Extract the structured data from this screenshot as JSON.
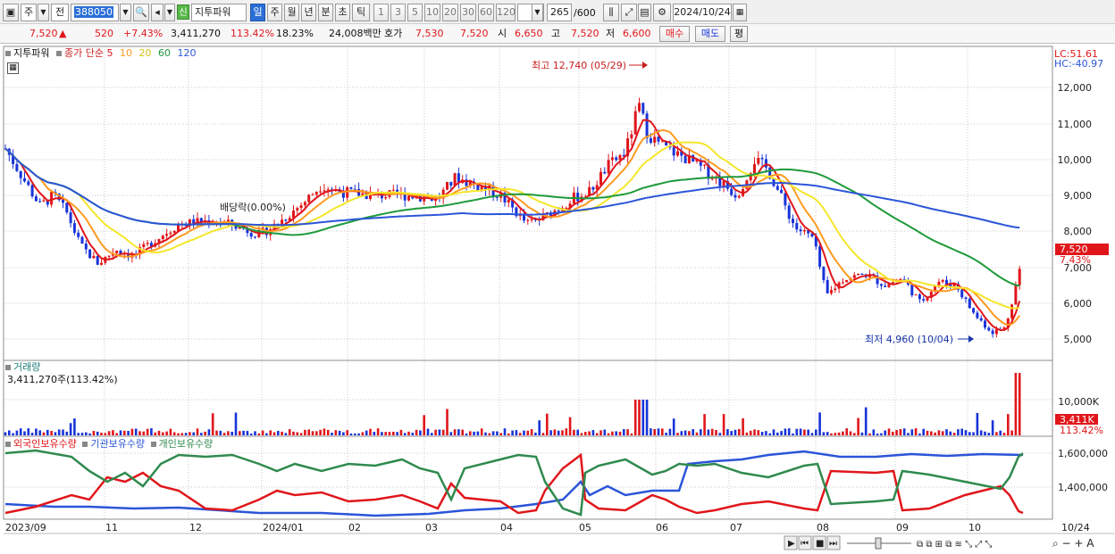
{
  "toolbar": {
    "jong_label": "주",
    "jeon_label": "전",
    "code": "388050",
    "sin_badge": "신",
    "stock_name": "지투파워",
    "periods": [
      "일",
      "주",
      "월",
      "년",
      "분",
      "초",
      "틱"
    ],
    "active_period": "일",
    "minute_options": [
      "1",
      "3",
      "5",
      "10",
      "20",
      "30",
      "60",
      "120"
    ],
    "count": "265",
    "count_total": "/600",
    "date": "2024/10/24"
  },
  "quote": {
    "price": "7,520",
    "change_sign": "▲",
    "change": "520",
    "change_pct": "+7.43%",
    "volume": "3,411,270",
    "volume_ratio": "113.42%",
    "turnover": "18.23%",
    "amount": "24,008백만",
    "hoga_label": "호가",
    "ask": "7,530",
    "bid": "7,520",
    "open_label": "시",
    "open": "6,650",
    "high_label": "고",
    "high": "7,520",
    "low_label": "저",
    "low": "6,600",
    "buy_label": "매수",
    "sell_label": "매도",
    "avg_label": "평"
  },
  "price_panel": {
    "name": "지투파워",
    "ma_title": "종가 단순",
    "ma_periods": [
      "5",
      "10",
      "20",
      "60",
      "120"
    ],
    "ma_colors": [
      "#e0161b",
      "#ff9a1f",
      "#f5e62a",
      "#1e9a3a",
      "#2b55d8"
    ],
    "lc": "LC:51.61",
    "hc": "HC:-40.97",
    "y_ticks": [
      "12,000",
      "11,000",
      "10,000",
      "9,000",
      "8,000",
      "7,000",
      "6,000",
      "5,000"
    ],
    "high_note": "최고 12,740 (05/29)",
    "low_note": "최저 4,960 (10/04)",
    "dividend_note": "배당락(0.00%)",
    "current_tag": "7,520",
    "current_pct": "7.43%"
  },
  "volume_panel": {
    "title": "거래량",
    "value": "3,411,270주(113.42%)",
    "y_tick": "10,000K",
    "current_tag": "3,411K",
    "current_pct": "113.42%"
  },
  "holding_panel": {
    "series": [
      "외국인보유수량",
      "기관보유수량",
      "개인보유수량"
    ],
    "colors": [
      "#e0161b",
      "#2b55d8",
      "#2f8a4e"
    ],
    "y_ticks": [
      "1,600,000",
      "1,400,000"
    ]
  },
  "x_axis": {
    "labels": [
      "2023/09",
      "11",
      "12",
      "2024/01",
      "02",
      "03",
      "04",
      "05",
      "06",
      "07",
      "08",
      "09",
      "10"
    ],
    "right_label": "10/24"
  },
  "chart_data": {
    "type": "candlestick",
    "title": "지투파워 388050",
    "ylim": [
      4800,
      12800
    ],
    "annotations": [
      {
        "label": "최고 12,740 (05/29)",
        "value": 12740
      },
      {
        "label": "최저 4,960 (10/04)",
        "value": 4960
      }
    ],
    "last_close": 7520,
    "moving_averages": [
      "5",
      "10",
      "20",
      "60",
      "120"
    ]
  }
}
